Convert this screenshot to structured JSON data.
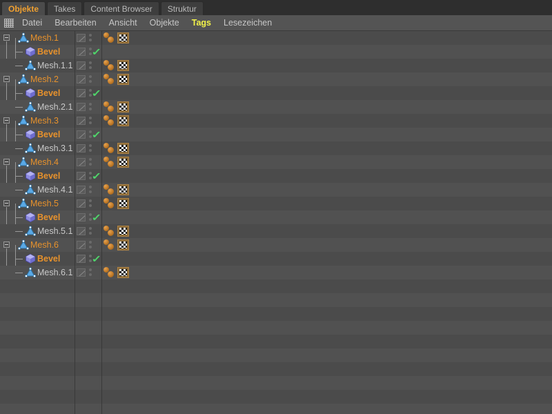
{
  "tabs": [
    {
      "label": "Objekte",
      "active": true
    },
    {
      "label": "Takes",
      "active": false
    },
    {
      "label": "Content Browser",
      "active": false
    },
    {
      "label": "Struktur",
      "active": false
    }
  ],
  "menu": {
    "grid_icon": "grid-icon",
    "items": [
      {
        "label": "Datei",
        "highlighted": false
      },
      {
        "label": "Bearbeiten",
        "highlighted": false
      },
      {
        "label": "Ansicht",
        "highlighted": false
      },
      {
        "label": "Objekte",
        "highlighted": false
      },
      {
        "label": "Tags",
        "highlighted": true
      },
      {
        "label": "Lesezeichen",
        "highlighted": false
      }
    ]
  },
  "colors": {
    "accent_orange": "#f0a030",
    "label_orange": "#e8922c",
    "label_grey": "#c9c9c9",
    "menu_highlight": "#f2f24a",
    "check_green": "#4fd46a",
    "panel_bg": "#4b4b4b",
    "row_stripe": "#515151",
    "tabbar_bg": "#2e2e2e",
    "menubar_bg": "#545454"
  },
  "tree": {
    "rows": [
      {
        "name": "Mesh.1",
        "depth": 0,
        "icon": "mesh-icon",
        "label_color": "orange",
        "bold": false,
        "expander": true,
        "check": false,
        "tags": [
          "material-tag",
          "texture-tag"
        ]
      },
      {
        "name": "Bevel",
        "depth": 1,
        "icon": "bevel-cube-icon",
        "label_color": "orange",
        "bold": true,
        "expander": false,
        "check": true,
        "tags": []
      },
      {
        "name": "Mesh.1.1",
        "depth": 1,
        "icon": "mesh-icon",
        "label_color": "grey",
        "bold": false,
        "expander": false,
        "check": false,
        "tags": [
          "material-tag",
          "texture-tag"
        ]
      },
      {
        "name": "Mesh.2",
        "depth": 0,
        "icon": "mesh-icon",
        "label_color": "orange",
        "bold": false,
        "expander": true,
        "check": false,
        "tags": [
          "material-tag",
          "texture-tag"
        ]
      },
      {
        "name": "Bevel",
        "depth": 1,
        "icon": "bevel-cube-icon",
        "label_color": "orange",
        "bold": true,
        "expander": false,
        "check": true,
        "tags": []
      },
      {
        "name": "Mesh.2.1",
        "depth": 1,
        "icon": "mesh-icon",
        "label_color": "grey",
        "bold": false,
        "expander": false,
        "check": false,
        "tags": [
          "material-tag",
          "texture-tag"
        ]
      },
      {
        "name": "Mesh.3",
        "depth": 0,
        "icon": "mesh-icon",
        "label_color": "orange",
        "bold": false,
        "expander": true,
        "check": false,
        "tags": [
          "material-tag",
          "texture-tag"
        ]
      },
      {
        "name": "Bevel",
        "depth": 1,
        "icon": "bevel-cube-icon",
        "label_color": "orange",
        "bold": true,
        "expander": false,
        "check": true,
        "tags": []
      },
      {
        "name": "Mesh.3.1",
        "depth": 1,
        "icon": "mesh-icon",
        "label_color": "grey",
        "bold": false,
        "expander": false,
        "check": false,
        "tags": [
          "material-tag",
          "texture-tag"
        ]
      },
      {
        "name": "Mesh.4",
        "depth": 0,
        "icon": "mesh-icon",
        "label_color": "orange",
        "bold": false,
        "expander": true,
        "check": false,
        "tags": [
          "material-tag",
          "texture-tag"
        ]
      },
      {
        "name": "Bevel",
        "depth": 1,
        "icon": "bevel-cube-icon",
        "label_color": "orange",
        "bold": true,
        "expander": false,
        "check": true,
        "tags": []
      },
      {
        "name": "Mesh.4.1",
        "depth": 1,
        "icon": "mesh-icon",
        "label_color": "grey",
        "bold": false,
        "expander": false,
        "check": false,
        "tags": [
          "material-tag",
          "texture-tag"
        ]
      },
      {
        "name": "Mesh.5",
        "depth": 0,
        "icon": "mesh-icon",
        "label_color": "orange",
        "bold": false,
        "expander": true,
        "check": false,
        "tags": [
          "material-tag",
          "texture-tag"
        ]
      },
      {
        "name": "Bevel",
        "depth": 1,
        "icon": "bevel-cube-icon",
        "label_color": "orange",
        "bold": true,
        "expander": false,
        "check": true,
        "tags": []
      },
      {
        "name": "Mesh.5.1",
        "depth": 1,
        "icon": "mesh-icon",
        "label_color": "grey",
        "bold": false,
        "expander": false,
        "check": false,
        "tags": [
          "material-tag",
          "texture-tag"
        ]
      },
      {
        "name": "Mesh.6",
        "depth": 0,
        "icon": "mesh-icon",
        "label_color": "orange",
        "bold": false,
        "expander": true,
        "check": false,
        "tags": [
          "material-tag",
          "texture-tag"
        ]
      },
      {
        "name": "Bevel",
        "depth": 1,
        "icon": "bevel-cube-icon",
        "label_color": "orange",
        "bold": true,
        "expander": false,
        "check": true,
        "tags": []
      },
      {
        "name": "Mesh.6.1",
        "depth": 1,
        "icon": "mesh-icon",
        "label_color": "grey",
        "bold": false,
        "expander": false,
        "check": false,
        "tags": [
          "material-tag",
          "texture-tag"
        ]
      }
    ]
  }
}
